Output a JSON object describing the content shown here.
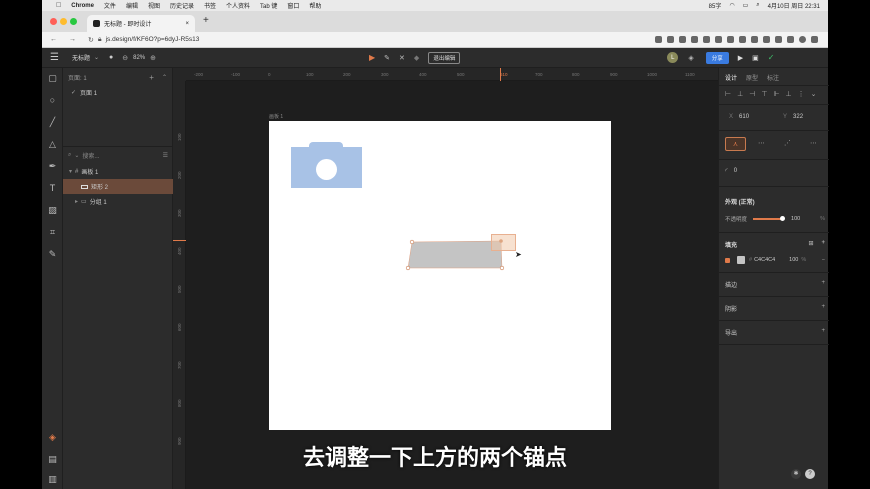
{
  "macos": {
    "app": "Chrome",
    "menus": [
      "文件",
      "编辑",
      "视图",
      "历史记录",
      "书签",
      "个人资料",
      "Tab 键",
      "窗口",
      "帮助"
    ],
    "status": "85字",
    "clock": "4月10日 周日 22:31"
  },
  "browser": {
    "tab_title": "无标题 - 即时设计",
    "url": "js.design/f/KF6O?p=6dyJ-R5s13"
  },
  "app": {
    "file_name": "无标题",
    "zoom": "82%",
    "exit_edit": "退出编辑",
    "share": "分享",
    "avatar": "L"
  },
  "layers": {
    "page_header": "页面: 1",
    "page_item": "页面 1",
    "search_placeholder": "搜索...",
    "items": [
      {
        "label": "画板 1",
        "icon": "frame-icon",
        "selected": false
      },
      {
        "label": "矩形 2",
        "icon": "rect-icon",
        "selected": true
      },
      {
        "label": "分组 1",
        "icon": "group-icon",
        "selected": false
      }
    ]
  },
  "canvas": {
    "artboard_label": "画板 1",
    "h_ticks": [
      "-200",
      "-100",
      "0",
      "100",
      "200",
      "300",
      "400",
      "500",
      "610",
      "700",
      "800",
      "900",
      "1000",
      "1100"
    ],
    "v_ticks": [
      "100",
      "200",
      "300",
      "400",
      "500",
      "600",
      "700",
      "800",
      "900"
    ],
    "shape_fill": "#c4c4c4",
    "camera_color": "#a8c2e6"
  },
  "inspector": {
    "tabs": [
      "设计",
      "原型",
      "标注"
    ],
    "x_label": "X",
    "x_value": "610",
    "y_label": "Y",
    "y_value": "322",
    "radius_value": "0",
    "appearance_title": "外观 (正常)",
    "opacity_label": "不透明度",
    "opacity_value": "100",
    "percent": "%",
    "fill_title": "填充",
    "fill_hex": "C4C4C4",
    "fill_opacity": "100",
    "stroke_title": "描边",
    "shadow_title": "阴影",
    "export_title": "导出",
    "accent": "#c87a4f"
  },
  "subtitle": "去调整一下上方的两个锚点"
}
